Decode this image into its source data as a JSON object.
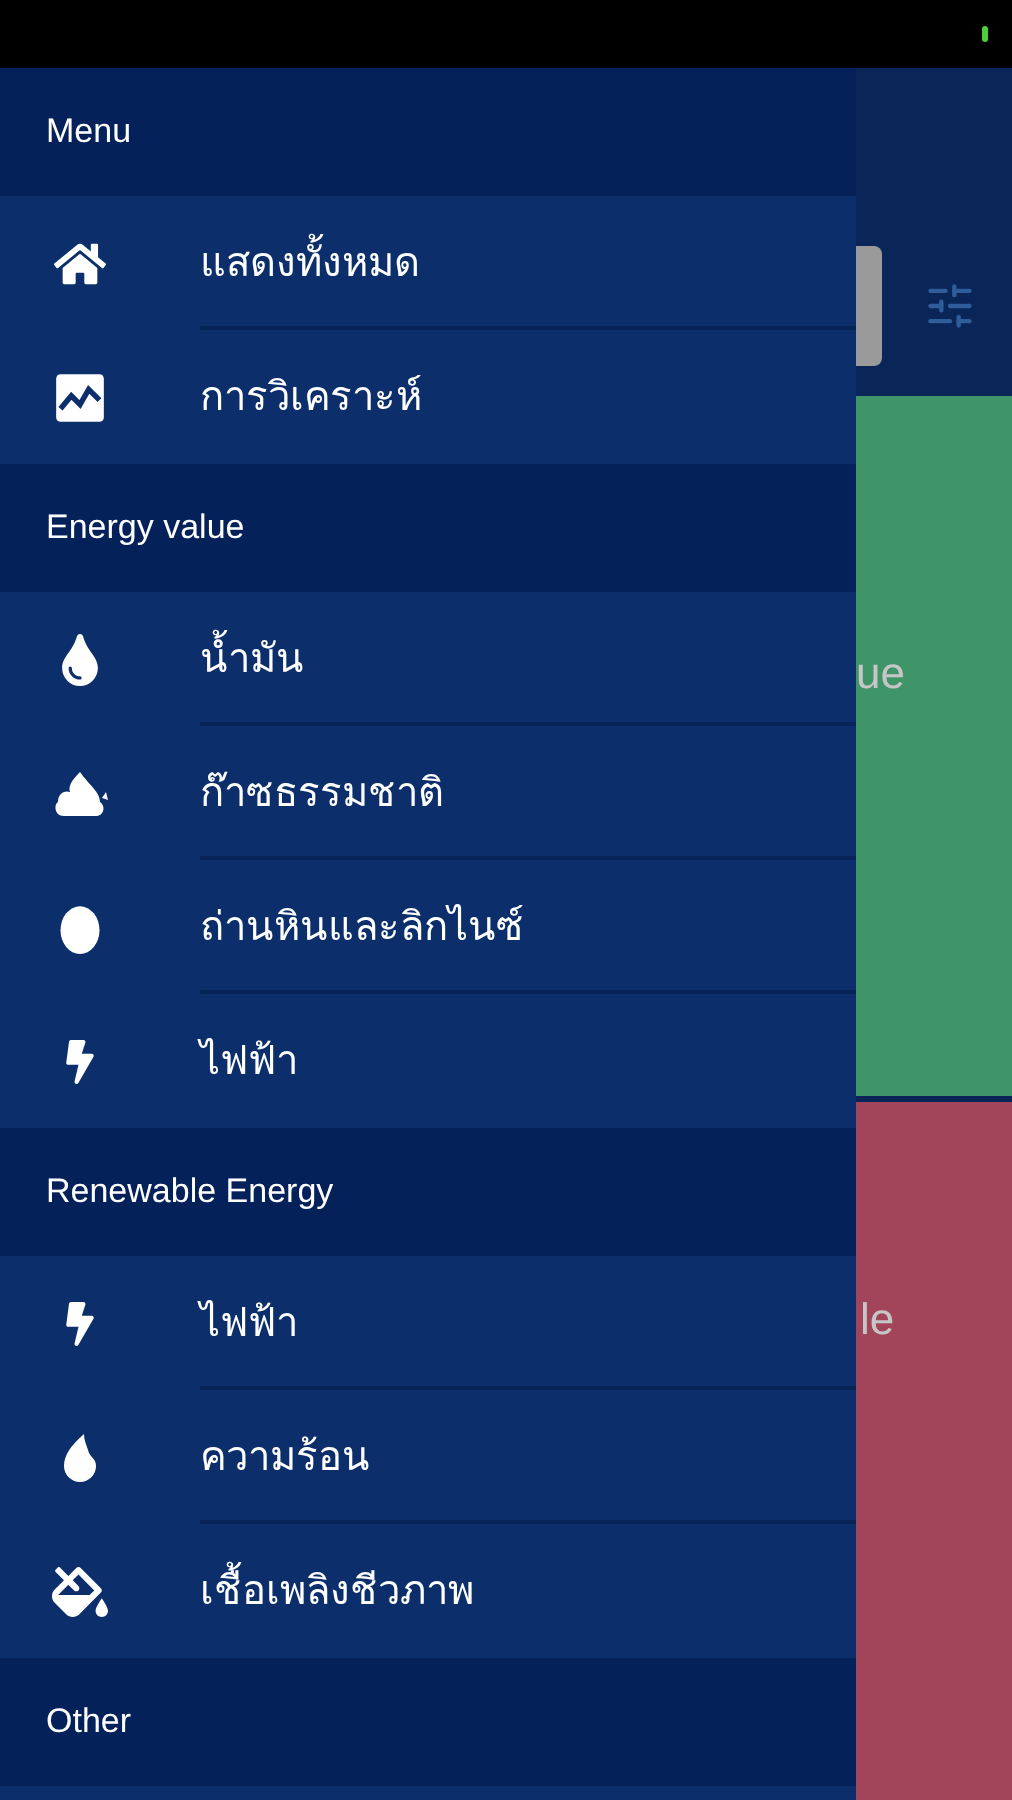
{
  "drawer": {
    "sections": [
      {
        "title": "Menu",
        "items": [
          {
            "label": "แสดงทั้งหมด"
          },
          {
            "label": "การวิเคราะห์"
          }
        ]
      },
      {
        "title": "Energy value",
        "items": [
          {
            "label": "น้ำมัน"
          },
          {
            "label": "ก๊าซธรรมชาติ"
          },
          {
            "label": "ถ่านหินและลิกไนซ์"
          },
          {
            "label": "ไฟฟ้า"
          }
        ]
      },
      {
        "title": "Renewable Energy",
        "items": [
          {
            "label": "ไฟฟ้า"
          },
          {
            "label": "ความร้อน"
          },
          {
            "label": "เชื้อเพลิงชีวภาพ"
          }
        ]
      },
      {
        "title": "Other"
      }
    ]
  },
  "background": {
    "cards": [
      {
        "text": "ue",
        "color": "#3f9468"
      },
      {
        "text": "le",
        "color": "#a3455a"
      }
    ]
  }
}
